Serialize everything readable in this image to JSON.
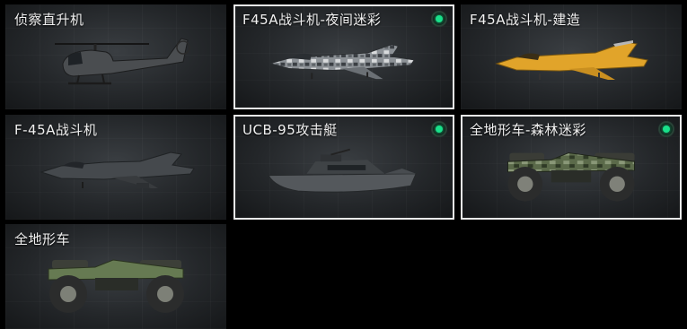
{
  "cards": [
    {
      "label": "侦察直升机",
      "selected": false,
      "badge": false,
      "icon": "helicopter-icon"
    },
    {
      "label": "F45A战斗机-夜间迷彩",
      "selected": true,
      "badge": true,
      "icon": "jet-camo-icon"
    },
    {
      "label": "F45A战斗机-建造",
      "selected": false,
      "badge": false,
      "icon": "jet-yellow-icon"
    },
    {
      "label": "F-45A战斗机",
      "selected": false,
      "badge": false,
      "icon": "jet-stealth-icon"
    },
    {
      "label": "UCB-95攻击艇",
      "selected": true,
      "badge": true,
      "icon": "boat-icon"
    },
    {
      "label": "全地形车-森林迷彩",
      "selected": true,
      "badge": true,
      "icon": "atv-camo-icon"
    },
    {
      "label": "全地形车",
      "selected": false,
      "badge": false,
      "icon": "atv-green-icon"
    }
  ],
  "colors": {
    "badge": "#19e08a",
    "selected_border": "#e9eaea"
  }
}
